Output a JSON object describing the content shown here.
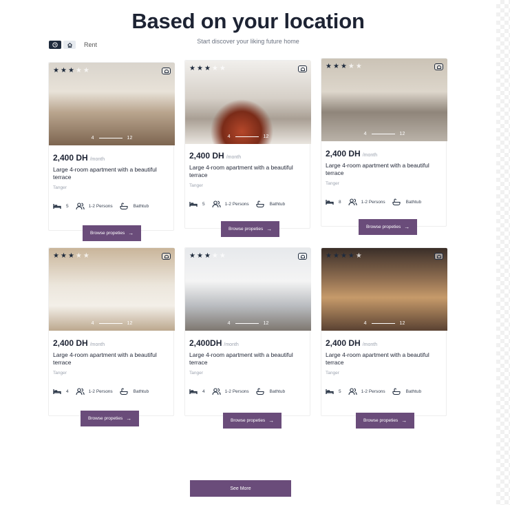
{
  "header": {
    "title": "Based on your location",
    "subtitle": "Start discover your liking future home"
  },
  "filters": {
    "clock_icon": "clock-icon",
    "home_icon": "home-icon",
    "label": "Rent"
  },
  "listings": [
    {
      "stars": 3,
      "price": "2,400 DH",
      "per": "/month",
      "title": "Large 4-room apartment with a beautiful terrace",
      "city": "Tanger",
      "beds": "5",
      "persons": "1-2 Persons",
      "bath": "Bathtub",
      "photo_index": "4",
      "photo_total": "12",
      "cta": "Browse propeties"
    },
    {
      "stars": 3,
      "price": "2,400 DH",
      "per": "/month",
      "title": "Large 4-room apartment with a beautiful terrace",
      "city": "Tanger",
      "beds": "5",
      "persons": "1-2 Persons",
      "bath": "Bathtub",
      "photo_index": "4",
      "photo_total": "12",
      "cta": "Browse propeties"
    },
    {
      "stars": 3,
      "price": "2,400 DH",
      "per": "/month",
      "title": "Large 4-room apartment with a beautiful terrace",
      "city": "Tanger",
      "beds": "8",
      "persons": "1-2 Persons",
      "bath": "Bathtub",
      "photo_index": "4",
      "photo_total": "12",
      "cta": "Browse propeties"
    },
    {
      "stars": 3,
      "price": "2,400 DH",
      "per": "/month",
      "title": "Large 4-room apartment with a beautiful terrace",
      "city": "Tanger",
      "beds": "4",
      "persons": "1-2 Persons",
      "bath": "Bathtub",
      "photo_index": "4",
      "photo_total": "12",
      "cta": "Browse propeties"
    },
    {
      "stars": 3,
      "price": "2,400DH",
      "per": "/month",
      "title": "Large 4-room apartment with a beautiful terrace",
      "city": "Tanger",
      "beds": "4",
      "persons": "1-2 Persons",
      "bath": "Bathtub",
      "photo_index": "4",
      "photo_total": "12",
      "cta": "Browse propeties"
    },
    {
      "stars": 4,
      "price": "2,400 DH",
      "per": "/month",
      "title": "Large 4-room apartment with a beautiful terrace",
      "city": "Tanger",
      "beds": "5",
      "persons": "1-2 Persons",
      "bath": "Bathtub",
      "photo_index": "4",
      "photo_total": "12",
      "cta": "Browse propeties"
    }
  ],
  "see_more": "See More",
  "colors": {
    "accent": "#6a4c7a",
    "dark": "#1f2b3d",
    "muted": "#9ca3af"
  }
}
